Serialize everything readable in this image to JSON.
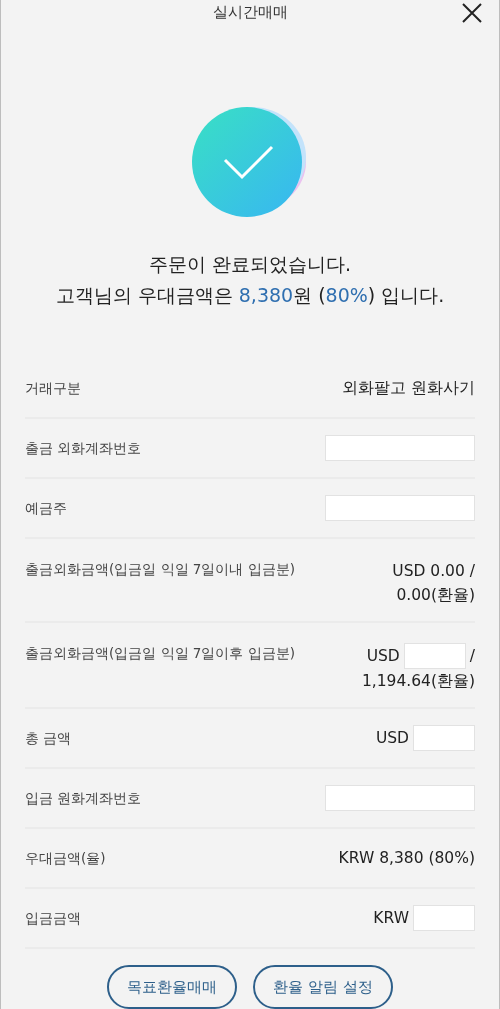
{
  "header": {
    "title": "실시간매매"
  },
  "message": {
    "line_1": "주문이 완료되었습니다.",
    "line_2": [
      {
        "kind": "text",
        "text": "고객님의 우대금액은 "
      },
      {
        "kind": "accent",
        "text": "8,380"
      },
      {
        "kind": "text",
        "text": "원 ("
      },
      {
        "kind": "accent",
        "text": "80%"
      },
      {
        "kind": "text",
        "text": ") 입니다."
      }
    ]
  },
  "rows": [
    {
      "label": "거래구분",
      "lines": [
        [
          {
            "kind": "text",
            "text": "외화팔고 원화사기"
          }
        ]
      ]
    },
    {
      "label": "출금 외화계좌번호",
      "lines": [
        [
          {
            "kind": "redacted"
          }
        ]
      ]
    },
    {
      "label": "예금주",
      "lines": [
        [
          {
            "kind": "redacted"
          }
        ]
      ]
    },
    {
      "label": "출금외화금액(입금일 익일 7일이내 입금분)",
      "lines": [
        [
          {
            "kind": "text",
            "text": "USD 0.00 /"
          }
        ],
        [
          {
            "kind": "text",
            "text": "0.00(환율)"
          }
        ]
      ]
    },
    {
      "label": "출금외화금액(입금일 익일 7일이후 입금분)",
      "lines": [
        [
          {
            "kind": "text",
            "text": "USD"
          },
          {
            "kind": "redacted"
          },
          {
            "kind": "text",
            "text": "/"
          }
        ],
        [
          {
            "kind": "text",
            "text": "1,194.64(환율)"
          }
        ]
      ]
    },
    {
      "label": "총 금액",
      "lines": [
        [
          {
            "kind": "text",
            "text": "USD"
          },
          {
            "kind": "redacted"
          }
        ]
      ]
    },
    {
      "label": "입금 원화계좌번호",
      "lines": [
        [
          {
            "kind": "redacted"
          }
        ]
      ]
    },
    {
      "label": "우대금액(율)",
      "lines": [
        [
          {
            "kind": "text",
            "text": "KRW 8,380 (80%)"
          }
        ]
      ]
    },
    {
      "label": "입금금액",
      "lines": [
        [
          {
            "kind": "text",
            "text": "KRW"
          },
          {
            "kind": "redacted"
          }
        ]
      ]
    }
  ],
  "buttons": [
    "목표환율매매",
    "환율 알림 설정"
  ]
}
